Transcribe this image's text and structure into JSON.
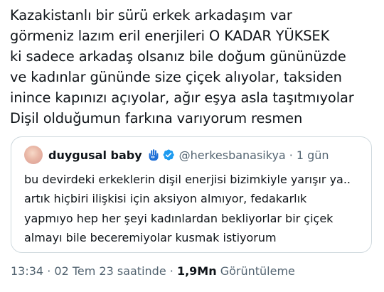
{
  "tweet": {
    "lines": [
      "Kazakistanlı bir sürü erkek arkadaşım var",
      "görmeniz lazım eril enerjileri O KADAR YÜKSEK",
      "ki sadece arkadaş olsanız bile doğum gününüzde",
      "ve kadınlar gününde size çiçek alıyolar, taksiden",
      "inince kapınızı açıyolar, ağır eşya asla taşıtmıyolar",
      "Dişil olduğumun farkına varıyorum resmen"
    ]
  },
  "quote": {
    "display_name": "duygusal baby",
    "handle": "@herkesbanasikya",
    "separator": "·",
    "time_ago": "1 gün",
    "hamsa_icon": "hamsa-hand-emoji",
    "verified_icon": "verified-badge",
    "verified_color": "#1d9bf0",
    "lines": [
      "bu devirdeki erkeklerin dişil enerjisi bizimkiyle yarışır ya..",
      "artık hiçbiri ilişkisi için aksiyon almıyor, fedakarlık",
      "yapmıyo hep her şeyi kadınlardan bekliyorlar bir çiçek",
      "almayı bile beceremiyolar kusmak istiyorum"
    ]
  },
  "meta": {
    "time": "13:34",
    "sep1": "·",
    "date": "02 Tem 23",
    "period": "saatinde",
    "sep2": "·",
    "views": "1,9Mn",
    "views_label": "Görüntüleme"
  }
}
